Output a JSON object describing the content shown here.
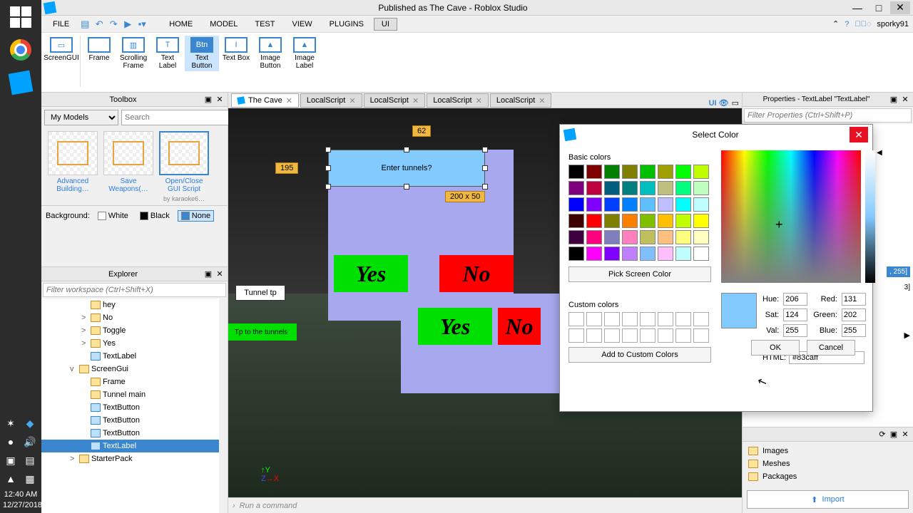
{
  "taskbar_clock": {
    "time": "12:40 AM",
    "date": "12/27/2018"
  },
  "window_title": "Published as The Cave - Roblox Studio",
  "account": "sporky91",
  "menu": {
    "file": "FILE",
    "tabs": [
      "HOME",
      "MODEL",
      "TEST",
      "VIEW",
      "PLUGINS",
      "UI"
    ]
  },
  "ribbon": [
    "ScreenGUI",
    "Frame",
    "Scrolling Frame",
    "Text Label",
    "Text Button",
    "Text Box",
    "Image Button",
    "Image Label"
  ],
  "toolbox": {
    "title": "Toolbox",
    "category": "My Models",
    "search_ph": "Search",
    "items": [
      "Advanced Building…",
      "Save Weapons(…",
      "Open/Close GUI Script"
    ],
    "by": "by karaoke6…",
    "bg_label": "Background:",
    "bg_opts": [
      "White",
      "Black",
      "None"
    ]
  },
  "explorer": {
    "title": "Explorer",
    "filter_ph": "Filter workspace (Ctrl+Shift+X)",
    "rows": [
      {
        "indent": 3,
        "label": "hey"
      },
      {
        "indent": 3,
        "label": "No",
        "exp": ">"
      },
      {
        "indent": 3,
        "label": "Toggle",
        "exp": ">"
      },
      {
        "indent": 3,
        "label": "Yes",
        "exp": ">"
      },
      {
        "indent": 3,
        "label": "TextLabel",
        "blue": true
      },
      {
        "indent": 2,
        "label": "ScreenGui",
        "exp": "v"
      },
      {
        "indent": 3,
        "label": "Frame"
      },
      {
        "indent": 3,
        "label": "Tunnel main"
      },
      {
        "indent": 3,
        "label": "TextButton",
        "blue": true
      },
      {
        "indent": 3,
        "label": "TextButton",
        "blue": true
      },
      {
        "indent": 3,
        "label": "TextButton",
        "blue": true
      },
      {
        "indent": 3,
        "label": "TextLabel",
        "blue": true,
        "sel": true
      },
      {
        "indent": 2,
        "label": "StarterPack",
        "exp": ">"
      }
    ]
  },
  "doc_tabs": [
    "The Cave",
    "LocalScript",
    "LocalScript",
    "LocalScript",
    "LocalScript"
  ],
  "viewport": {
    "label_text": "Enter tunnels?",
    "yes": "Yes",
    "no": "No",
    "ruler_top": "62",
    "ruler_left": "195",
    "size": "200 x 50",
    "tunneltp": "Tunnel tp",
    "tptunnels": "Tp to the tunnels"
  },
  "properties": {
    "title": "Properties - TextLabel \"TextLabel\"",
    "filter_ph": "Filter Properties (Ctrl+Shift+P)",
    "color_val": ", 255]",
    "size_val": "3]"
  },
  "assets": {
    "items": [
      "Images",
      "Meshes",
      "Packages"
    ],
    "import": "Import"
  },
  "cmdbar_ph": "Run a command",
  "color_dialog": {
    "title": "Select Color",
    "basic_label": "Basic colors",
    "pick": "Pick Screen Color",
    "custom_label": "Custom colors",
    "add": "Add to Custom Colors",
    "hue": "206",
    "sat": "124",
    "val": "255",
    "red": "131",
    "green": "202",
    "blue": "255",
    "html": "#83caff",
    "ok": "OK",
    "cancel": "Cancel",
    "basic": [
      "#000000",
      "#7f0000",
      "#007f00",
      "#7f7f00",
      "#00bf00",
      "#9f9f00",
      "#00ff00",
      "#bfff00",
      "#7f007f",
      "#bf003f",
      "#005f7f",
      "#007f7f",
      "#00bfbf",
      "#bfbf7f",
      "#00ff7f",
      "#bfffbf",
      "#0000ff",
      "#7f00ff",
      "#003fff",
      "#007fff",
      "#5fbfff",
      "#bfbfff",
      "#00ffff",
      "#bfffff",
      "#3f0000",
      "#ff0000",
      "#7f7f00",
      "#ff7f00",
      "#7fbf00",
      "#ffbf00",
      "#bfff00",
      "#ffff00",
      "#3f003f",
      "#ff007f",
      "#7f7fbf",
      "#ff7fbf",
      "#bfbf5f",
      "#ffbf7f",
      "#ffff7f",
      "#ffffbf",
      "#000000",
      "#ff00ff",
      "#7f00ff",
      "#bf7fff",
      "#7fbfff",
      "#ffbfff",
      "#bfffff",
      "#ffffff"
    ]
  }
}
